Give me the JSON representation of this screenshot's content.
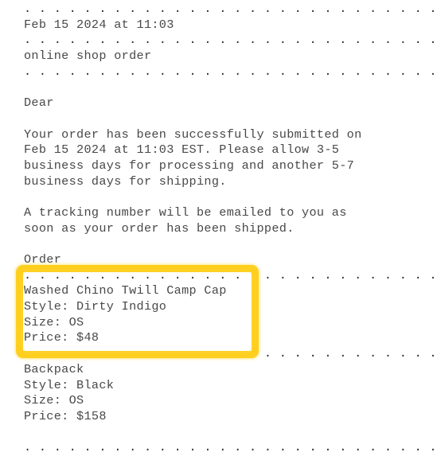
{
  "document": {
    "type": "order-confirmation-email",
    "divider_pattern": ". ",
    "divider_text": ". . . . . . . . . . . . . . . . . . . . . . . . . . . . . . . . . . .",
    "lines": [
      {
        "kind": "divider",
        "text": ". . . . . . . . . . . . . . . . . . . . . . . . . . . . . . . . . . ."
      },
      {
        "kind": "text",
        "text": "Feb 15 2024 at 11:03"
      },
      {
        "kind": "divider",
        "text": ". . . . . . . . . . . . . . . . . . . . . . . . . . . . . . . . . . ."
      },
      {
        "kind": "text",
        "text": "online shop order"
      },
      {
        "kind": "divider",
        "text": ". . . . . . . . . . . . . . . . . . . . . . . . . . . . . . . . . . ."
      },
      {
        "kind": "blank",
        "text": " "
      },
      {
        "kind": "text",
        "text": "Dear"
      },
      {
        "kind": "blank",
        "text": " "
      },
      {
        "kind": "text",
        "text": "Your order has been successfully submitted on"
      },
      {
        "kind": "text",
        "text": "Feb 15 2024 at 11:03 EST. Please allow 3-5"
      },
      {
        "kind": "text",
        "text": "business days for processing and another 5-7"
      },
      {
        "kind": "text",
        "text": "business days for shipping."
      },
      {
        "kind": "blank",
        "text": " "
      },
      {
        "kind": "text",
        "text": "A tracking number will be emailed to you as"
      },
      {
        "kind": "text",
        "text": "soon as your order has been shipped."
      },
      {
        "kind": "blank",
        "text": " "
      },
      {
        "kind": "text",
        "text": "Order"
      },
      {
        "kind": "divider",
        "text": ". . . . . . . . . . . . . . . . . . . . . . . . . . . . . . . . . . ."
      },
      {
        "kind": "text",
        "text": "Washed Chino Twill Camp Cap"
      },
      {
        "kind": "text",
        "text": "Style: Dirty Indigo"
      },
      {
        "kind": "text",
        "text": "Size: OS"
      },
      {
        "kind": "text",
        "text": "Price: $48"
      },
      {
        "kind": "divider",
        "text": ". . . . . . . . . . . . . . . . . . . . . . . . . . . . . . . . . . ."
      },
      {
        "kind": "text",
        "text": "Backpack"
      },
      {
        "kind": "text",
        "text": "Style: Black"
      },
      {
        "kind": "text",
        "text": "Size: OS"
      },
      {
        "kind": "text",
        "text": "Price: $158"
      },
      {
        "kind": "blank",
        "text": " "
      },
      {
        "kind": "divider",
        "text": ". . . . . . . . . . . . . . . . . . . . . . . . . . . . . . . . . . ."
      }
    ]
  },
  "header": {
    "timestamp": "Feb 15 2024 at 11:03",
    "subject": "online shop order",
    "greeting": "Dear"
  },
  "confirmation": {
    "paragraph_1": "Your order has been successfully submitted on Feb 15 2024 at 11:03 EST. Please allow 3-5 business days for processing and another 5-7 business days for shipping.",
    "paragraph_2": "A tracking number will be emailed to you as soon as your order has been shipped."
  },
  "order": {
    "section_label": "Order",
    "items": [
      {
        "name": "Washed Chino Twill Camp Cap",
        "style_label": "Style:",
        "style": "Dirty Indigo",
        "size_label": "Size:",
        "size": "OS",
        "price_label": "Price:",
        "price": "$48",
        "highlighted": true
      },
      {
        "name": "Backpack",
        "style_label": "Style:",
        "style": "Black",
        "size_label": "Size:",
        "size": "OS",
        "price_label": "Price:",
        "price": "$158",
        "highlighted": false
      }
    ]
  },
  "annotation": {
    "highlight_color": "#ffcf1f",
    "target": "Washed Chino Twill Camp Cap item block"
  },
  "colors": {
    "background": "#ffffff",
    "text": "#484848",
    "divider": "#2b2b2b",
    "highlight": "#ffcf1f"
  }
}
